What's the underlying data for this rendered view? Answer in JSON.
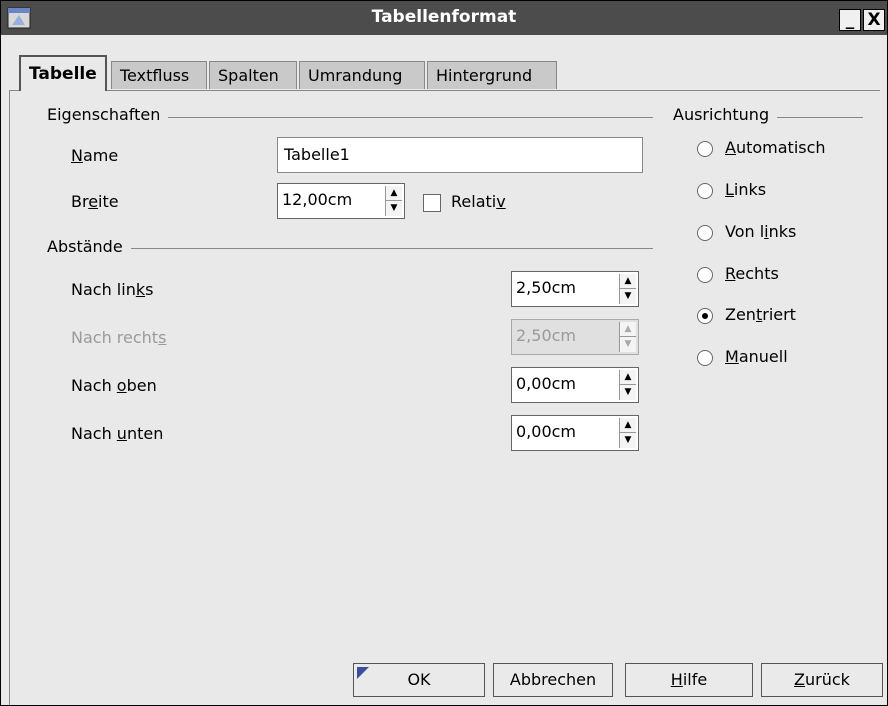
{
  "window": {
    "title": "Tabellenformat",
    "minimize_glyph": "_",
    "close_glyph": "X"
  },
  "tabs": [
    {
      "label": "Tabelle",
      "active": true
    },
    {
      "label": "Textfluss",
      "active": false
    },
    {
      "label": "Spalten",
      "active": false
    },
    {
      "label": "Umrandung",
      "active": false
    },
    {
      "label": "Hintergrund",
      "active": false
    }
  ],
  "eigenschaften": {
    "group_title": "Eigenschaften",
    "name_label_u": "N",
    "name_label_rest": "ame",
    "name_value": "Tabelle1",
    "breite_label_pre": "Br",
    "breite_label_u": "e",
    "breite_label_post": "ite",
    "breite_value": "12,00cm",
    "relativ_label_pre": "Relati",
    "relativ_label_u": "v"
  },
  "abstaende": {
    "group_title": "Abstände",
    "links_pre": "Nach lin",
    "links_u": "k",
    "links_post": "s",
    "links_value": "2,50cm",
    "rechts_pre": "Nach recht",
    "rechts_u": "s",
    "rechts_value": "2,50cm",
    "oben_pre": "Nach ",
    "oben_u": "o",
    "oben_post": "ben",
    "oben_value": "0,00cm",
    "unten_pre": "Nach ",
    "unten_u": "u",
    "unten_post": "nten",
    "unten_value": "0,00cm"
  },
  "ausrichtung": {
    "group_title": "Ausrichtung",
    "options": [
      {
        "u": "A",
        "rest_pre": "",
        "rest": "utomatisch",
        "checked": false
      },
      {
        "u": "L",
        "rest_pre": "",
        "rest": "inks",
        "checked": false
      },
      {
        "u": "i",
        "rest_pre": "Von l",
        "rest": "nks",
        "checked": false
      },
      {
        "u": "R",
        "rest_pre": "",
        "rest": "echts",
        "checked": false
      },
      {
        "u": "t",
        "rest_pre": "Zen",
        "rest": "riert",
        "checked": true
      },
      {
        "u": "M",
        "rest_pre": "",
        "rest": "anuell",
        "checked": false
      }
    ]
  },
  "buttons": {
    "ok": "OK",
    "abbrechen": "Abbrechen",
    "hilfe_u": "H",
    "hilfe_rest": "ilfe",
    "zurueck_u": "Z",
    "zurueck_rest": "urück"
  },
  "icons": {
    "app": "window-app-icon",
    "spin_up": "▲",
    "spin_down": "▼"
  },
  "colors": {
    "titlebar": "#4c4c4c",
    "dialog_bg": "#e9e9e9",
    "ok_corner": "#3a4fa0"
  }
}
